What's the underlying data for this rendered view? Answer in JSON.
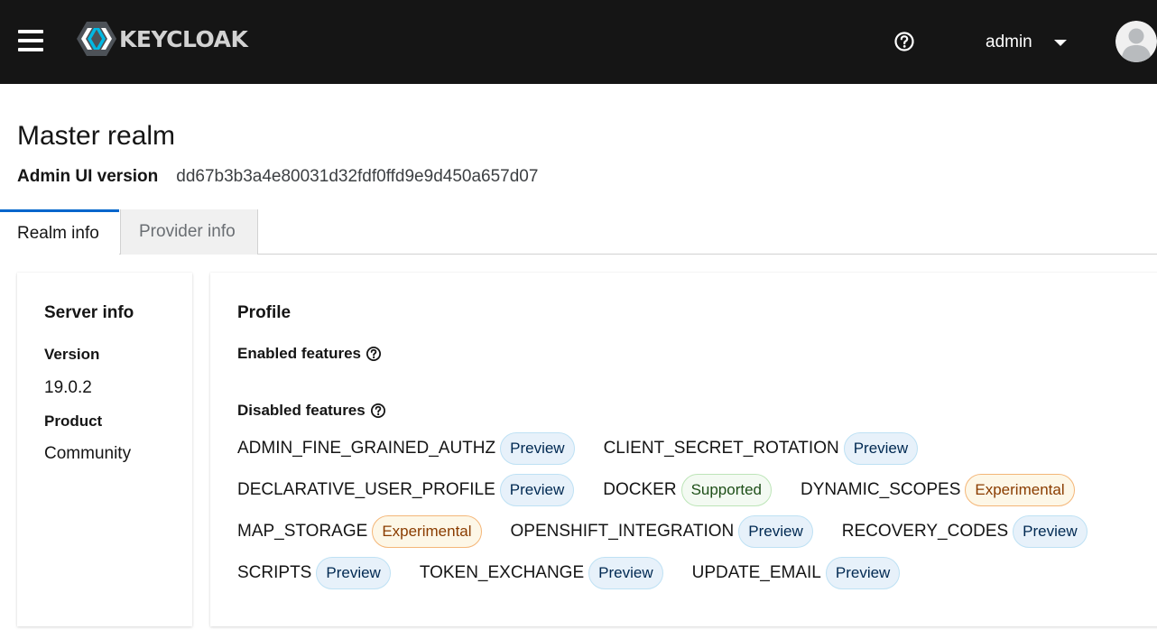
{
  "header": {
    "brand": "KEYCLOAK",
    "user_name": "admin",
    "colors": {
      "masthead": "#151515",
      "logo_blue": "#4d5258"
    }
  },
  "page": {
    "title": "Master realm",
    "version_label": "Admin UI version",
    "version_value": "dd67b3b3a4e80031d32fdf0ffd9e9d450a657d07"
  },
  "tabs": [
    {
      "label": "Realm info",
      "active": true
    },
    {
      "label": "Provider info",
      "active": false
    }
  ],
  "server_info": {
    "title": "Server info",
    "version_label": "Version",
    "version_value": "19.0.2",
    "product_label": "Product",
    "product_value": "Community"
  },
  "profile": {
    "title": "Profile",
    "enabled_label": "Enabled features",
    "disabled_label": "Disabled features",
    "disabled_rows": [
      [
        {
          "name": "ADMIN_FINE_GRAINED_AUTHZ",
          "badge": "Preview"
        },
        {
          "name": "CLIENT_SECRET_ROTATION",
          "badge": "Preview"
        }
      ],
      [
        {
          "name": "DECLARATIVE_USER_PROFILE",
          "badge": "Preview"
        },
        {
          "name": "DOCKER",
          "badge": "Supported"
        },
        {
          "name": "DYNAMIC_SCOPES",
          "badge": "Experimental"
        }
      ],
      [
        {
          "name": "MAP_STORAGE",
          "badge": "Experimental"
        },
        {
          "name": "OPENSHIFT_INTEGRATION",
          "badge": "Preview"
        },
        {
          "name": "RECOVERY_CODES",
          "badge": "Preview"
        }
      ],
      [
        {
          "name": "SCRIPTS",
          "badge": "Preview"
        },
        {
          "name": "TOKEN_EXCHANGE",
          "badge": "Preview"
        },
        {
          "name": "UPDATE_EMAIL",
          "badge": "Preview"
        }
      ]
    ]
  },
  "icons": {
    "menu": "hamburger-icon",
    "help": "question-circle-icon",
    "user_dropdown": "caret-down-icon",
    "avatar": "user-avatar-icon",
    "feature_help": "question-circle-icon"
  }
}
